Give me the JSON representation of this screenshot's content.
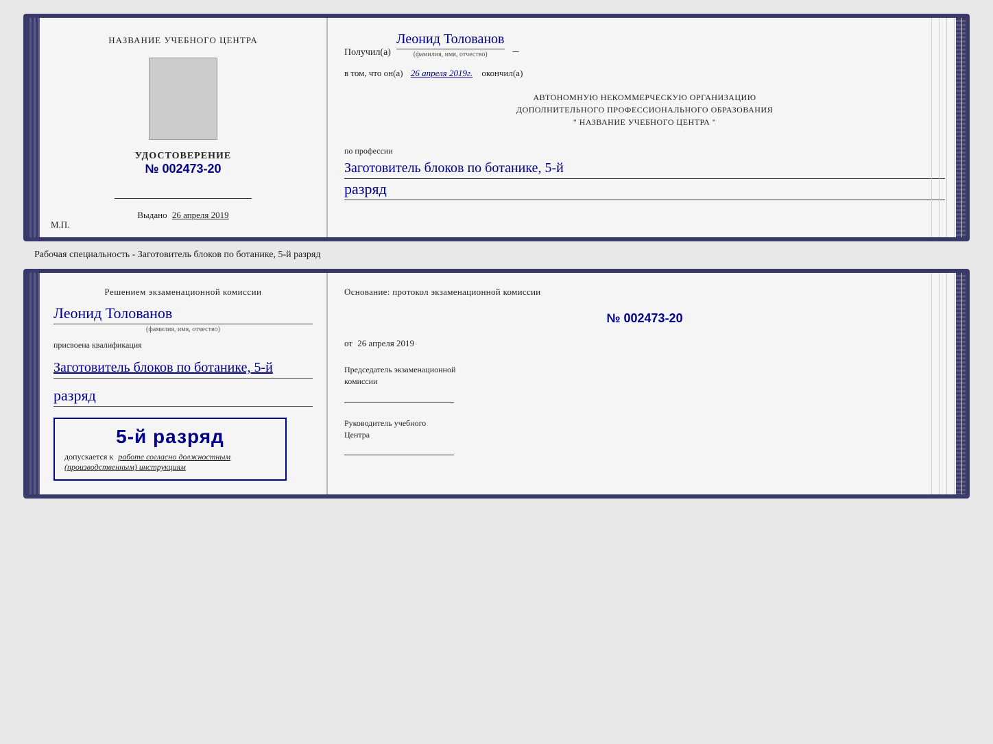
{
  "card1": {
    "left": {
      "center_title": "НАЗВАНИЕ УЧЕБНОГО ЦЕНТРА",
      "cert_title": "УДОСТОВЕРЕНИЕ",
      "cert_number_prefix": "№",
      "cert_number": "002473-20",
      "issued_label": "Выдано",
      "issued_date": "26 апреля 2019",
      "mp_label": "М.П."
    },
    "right": {
      "received_label": "Получил(а)",
      "recipient_name": "Леонид Толованов",
      "name_hint": "(фамилия, имя, отчество)",
      "in_that_label": "в том, что он(а)",
      "date_handwritten": "26 апреля 2019г.",
      "finished_label": "окончил(а)",
      "org_line1": "АВТОНОМНУЮ НЕКОММЕРЧЕСКУЮ ОРГАНИЗАЦИЮ",
      "org_line2": "ДОПОЛНИТЕЛЬНОГО ПРОФЕССИОНАЛЬНОГО ОБРАЗОВАНИЯ",
      "org_line3": "\"  НАЗВАНИЕ УЧЕБНОГО ЦЕНТРА  \"",
      "profession_label": "по профессии",
      "profession_handwritten": "Заготовитель блоков по ботанике, 5-й",
      "razryad_handwritten": "разряд"
    }
  },
  "caption": "Рабочая специальность - Заготовитель блоков по ботанике, 5-й разряд",
  "card2": {
    "left": {
      "commission_text": "Решением экзаменационной комиссии",
      "name_handwritten": "Леонид Толованов",
      "name_hint": "(фамилия, имя, отчество)",
      "qualification_label": "присвоена квалификация",
      "qualification_handwritten": "Заготовитель блоков по ботанике, 5-й",
      "razryad_handwritten": "разряд",
      "stamp_main": "5-й разряд",
      "stamp_sub1": "допускается к",
      "stamp_sub2": "работе согласно должностным",
      "stamp_sub3": "(производственным) инструкциям"
    },
    "right": {
      "osnov_label": "Основание: протокол экзаменационной комиссии",
      "protocol_prefix": "№",
      "protocol_number": "002473-20",
      "ot_label": "от",
      "ot_date": "26 апреля 2019",
      "chairman_line1": "Председатель экзаменационной",
      "chairman_line2": "комиссии",
      "head_line1": "Руководитель учебного",
      "head_line2": "Центра"
    }
  }
}
